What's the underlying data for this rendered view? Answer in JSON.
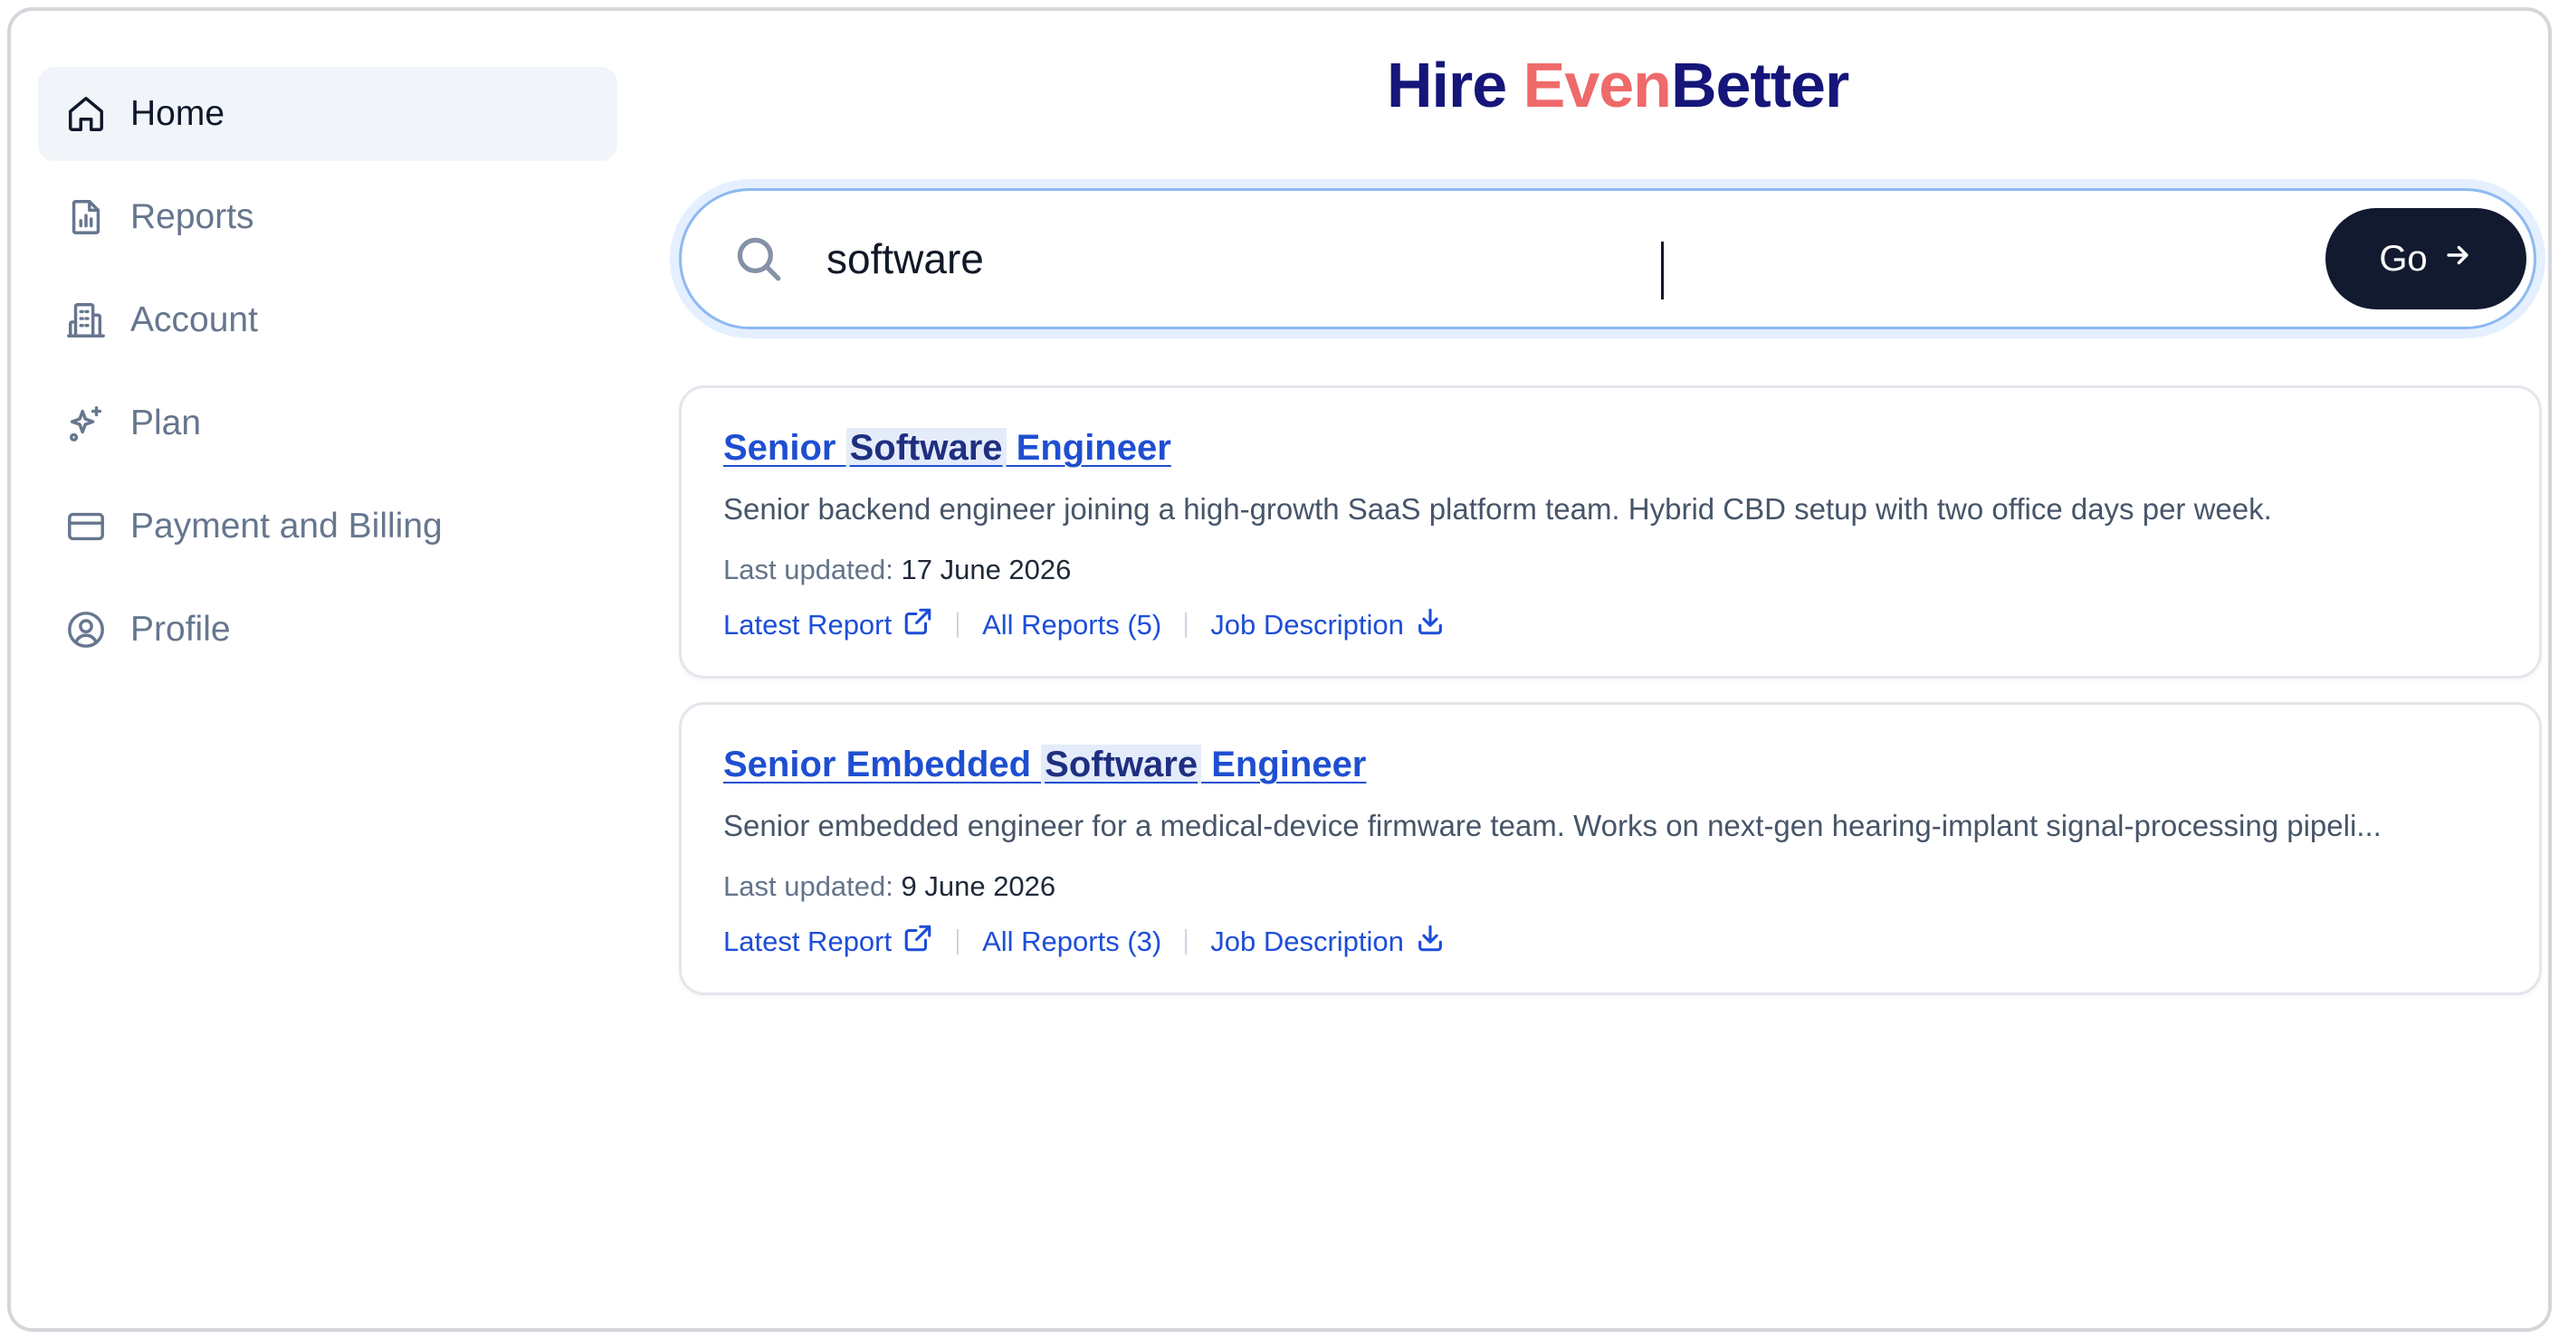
{
  "brand": {
    "part1": "Hire ",
    "part2": "Even",
    "part3": "Better"
  },
  "sidebar": {
    "items": [
      {
        "label": "Home",
        "icon": "home-icon",
        "active": true
      },
      {
        "label": "Reports",
        "icon": "report-file-icon"
      },
      {
        "label": "Account",
        "icon": "building-icon"
      },
      {
        "label": "Plan",
        "icon": "sparkles-icon"
      },
      {
        "label": "Payment and Billing",
        "icon": "credit-card-icon"
      },
      {
        "label": "Profile",
        "icon": "user-circle-icon"
      }
    ]
  },
  "search": {
    "value": "software",
    "button_label": "Go"
  },
  "results": [
    {
      "title_before": "Senior ",
      "title_match": "Software",
      "title_after": " Engineer",
      "description": "Senior backend engineer joining a high-growth SaaS platform team. Hybrid CBD setup with two office days per week.",
      "updated_label": "Last updated: ",
      "updated_date": "17 June 2026",
      "latest_report": "Latest Report",
      "all_reports": "All Reports (5)",
      "job_description": "Job Description"
    },
    {
      "title_before": "Senior Embedded ",
      "title_match": "Software",
      "title_after": " Engineer",
      "description": "Senior embedded engineer for a medical-device firmware team. Works on next-gen hearing-implant signal-processing pipeli...",
      "updated_label": "Last updated: ",
      "updated_date": "9 June 2026",
      "latest_report": "Latest Report",
      "all_reports": "All Reports (3)",
      "job_description": "Job Description"
    }
  ],
  "colors": {
    "brand_navy": "#15157a",
    "brand_coral": "#ef6a6a",
    "link_blue": "#1d4ed8",
    "button_dark": "#111a2e"
  }
}
